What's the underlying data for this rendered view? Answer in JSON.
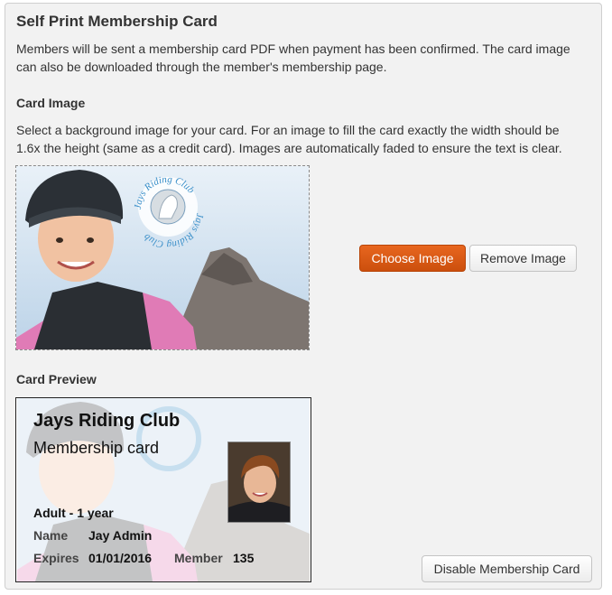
{
  "section": {
    "title": "Self Print Membership Card",
    "intro": "Members will be sent a membership card PDF when payment has been confirmed. The card image can also be downloaded through the member's membership page."
  },
  "card_image": {
    "heading": "Card Image",
    "description": "Select a background image for your card. For an image to fill the card exactly the width should be 1.6x the height (same as a credit card). Images are automatically faded to ensure the text is clear.",
    "logo_text_top": "Jays Riding Club",
    "logo_text_bottom": "Jays Riding Club",
    "choose_label": "Choose Image",
    "remove_label": "Remove Image"
  },
  "card_preview": {
    "heading": "Card Preview",
    "club_name": "Jays Riding Club",
    "card_title": "Membership card",
    "membership_type": "Adult - 1 year",
    "name_label": "Name",
    "name_value": "Jay Admin",
    "expires_label": "Expires",
    "expires_value": "01/01/2016",
    "member_label": "Member",
    "member_value": "135"
  },
  "disable_label": "Disable Membership Card",
  "colors": {
    "primary_button": "#d95a16",
    "panel_background": "#f2f2f2",
    "logo_blue": "#3a8fc9"
  }
}
